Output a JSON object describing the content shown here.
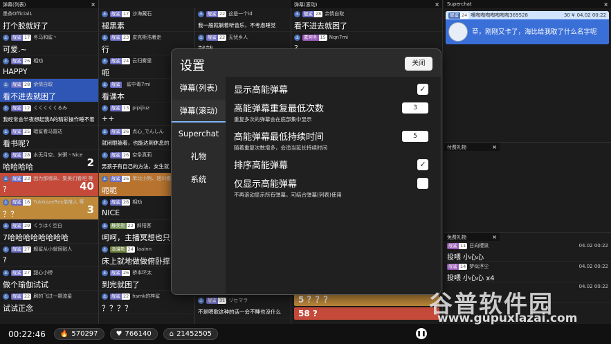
{
  "panels": {
    "list_title": "弹幕(列表)",
    "scroll_title": "弹幕(滚动)",
    "superchat_title": "Superchat",
    "paid_gift_title": "付费礼物",
    "free_gift_title": "免费礼物",
    "close": "×"
  },
  "col1": [
    {
      "user": "墨茶Official1",
      "text": "打个胶就好了",
      "style": ""
    },
    {
      "badge": "舰鲨",
      "level": "17",
      "user": "冬马和鲨丶",
      "text": "可爱.~",
      "style": ""
    },
    {
      "badge": "舰鲨",
      "level": "26",
      "user": "相劝",
      "text": "HAPPY",
      "style": ""
    },
    {
      "badge": "舰鲨",
      "level": "28",
      "user": "余情自取",
      "text": "看不进去就困了",
      "style": "hl-blue"
    },
    {
      "badge": "舰鲨",
      "level": "12",
      "user": "くくくくくるみ",
      "text": "我经常会半夜想起我A的精彩操作睡不着",
      "style": "",
      "small": true
    },
    {
      "badge": "舰鲨",
      "level": "25",
      "user": "暗鲨看马雷达",
      "text": "看书呢?",
      "style": ""
    },
    {
      "badge": "舰鲨",
      "level": "28",
      "user": "水无月空、米粥丶Nice",
      "text": "哈哈哈哈",
      "style": "",
      "count": "2"
    },
    {
      "badge": "舰鲨",
      "level": "23",
      "user": "因为那哪来、集美们看吧 等",
      "text": "?",
      "style": "hl-red",
      "count": "40"
    },
    {
      "badge": "舰鲨",
      "level": "16",
      "user": "YukikazeRex单推人 等",
      "text": "？？",
      "style": "hl-orange",
      "count": "3"
    },
    {
      "badge": "舰鲨",
      "level": "29",
      "user": "くうはく空白",
      "text": "7哈哈哈哈哈哈哈哈",
      "style": ""
    },
    {
      "badge": "舰鲨",
      "level": "27",
      "user": "舰鲨从小就很贴人",
      "text": "?",
      "style": ""
    },
    {
      "badge": "舰鲨",
      "level": "27",
      "user": "甜心小桥",
      "text": "做个瑜伽试试",
      "style": ""
    },
    {
      "badge": "舰鲨",
      "level": "22",
      "user": "刷的飞过一颗流星",
      "text": "试试正念",
      "style": ""
    }
  ],
  "col2": [
    {
      "badge": "舰鲨",
      "level": "17",
      "user": "沙海藏石",
      "text": "褪黑素",
      "style": ""
    },
    {
      "badge": "舰鲨",
      "level": "23",
      "user": "皮克斯浩着走",
      "text": "行",
      "style": ""
    },
    {
      "badge": "舰鲨",
      "level": "24",
      "user": "云归雾里",
      "text": "呃",
      "style": ""
    },
    {
      "badge": "舰鲨",
      "level": "",
      "user": "鲨中毒7mi",
      "text": "看课本",
      "style": ""
    },
    {
      "badge": "舰鲨",
      "level": "13",
      "user": "pipijiuz",
      "text": "++",
      "style": ""
    },
    {
      "badge": "舰鲨",
      "level": "26",
      "user": "点心_でんしん",
      "text": "就闭眼躺着，也能达到休息的",
      "style": "",
      "small": true
    },
    {
      "badge": "舰鲨",
      "level": "26",
      "user": "空条真莉",
      "text": "男孩子有自己的方法，女生就",
      "style": "",
      "small": true
    },
    {
      "badge": "舰鲨",
      "level": "26",
      "user": "苯比小狗、旭川看",
      "text": "呃呃",
      "style": "hl-dorange"
    },
    {
      "badge": "舰鲨",
      "level": "26",
      "user": "相劝",
      "text": "NICE",
      "style": ""
    },
    {
      "badge": "静美熊",
      "level": "22",
      "user": "斜阳客",
      "text": "呵呵，主播冥想也只会",
      "style": ""
    },
    {
      "badge": "浪漫熊",
      "level": "24",
      "user": "laainn",
      "text": "床上就地做做俯卧撑",
      "style": ""
    },
    {
      "badge": "舰鲨",
      "level": "26",
      "user": "桥本环太",
      "text": "到完就困了",
      "style": ""
    },
    {
      "badge": "舰鲨",
      "level": "22",
      "user": "hsmk的梓鲨",
      "text": "？？？？",
      "style": ""
    }
  ],
  "col3": [
    {
      "badge": "舰鲨",
      "level": "22",
      "user": "这是一个id",
      "text": "我一般就躺着听音乐，不考虑睡觉",
      "style": "",
      "small": true
    },
    {
      "badge": "舰鲨",
      "level": "22",
      "user": "无忧乡人",
      "text": "就就",
      "style": ""
    },
    {
      "badge": "舰鲨",
      "level": "31",
      "user": "リセマラ",
      "text": "不是嗯歌这种的话一会不睡也没什么",
      "style": "",
      "small": true,
      "bottom": true
    }
  ],
  "col4": [
    {
      "badge": "舰鲨",
      "level": "28",
      "user": "余情自取",
      "text": "看不进去就困了",
      "style": ""
    },
    {
      "badge": "素阿冬",
      "level": "15",
      "user": "Nqn7mi",
      "text": "?",
      "style": ""
    }
  ],
  "col4_bottom": [
    {
      "text": "5 ？？？",
      "style": "hl-orange"
    },
    {
      "text": "58 ?",
      "style": "hl-red"
    }
  ],
  "superchat": {
    "badge": "舰鲨",
    "level": "24",
    "user": "嘴啕啕啕啕啕啕啕369528",
    "price": "30 ¥",
    "time": "04.02 00:22",
    "text": "草，刚刚又卡了，海比给我取了什么名字呢"
  },
  "free_gifts": [
    {
      "badge": "舰鲨",
      "level": "11",
      "user": "日向櫻泉",
      "time": "04.02 00:22",
      "text": "投喂 小心心"
    },
    {
      "badge": "舰鲨",
      "level": "14",
      "user": "梦似浮尘",
      "time": "04.02 00:22",
      "text": "投喂 小心心 x4"
    },
    {
      "badge": "",
      "level": "",
      "user": "",
      "time": "04.02 00:22",
      "text": ""
    }
  ],
  "settings": {
    "title": "设置",
    "close_label": "关闭",
    "tabs": [
      "弹幕(列表)",
      "弹幕(滚动)",
      "Superchat",
      "礼物",
      "系统"
    ],
    "active_tab": 1,
    "show_highenergy": {
      "label": "显示高能弹幕",
      "checked": true
    },
    "min_repeat": {
      "label": "高能弹幕重复最低次数",
      "desc": "重复多次的弹幕会在底部集中显示",
      "value": "3"
    },
    "min_duration": {
      "label": "高能弹幕最低持续时间",
      "desc": "随着重复次数增多，会适当延长持续时间",
      "value": "5"
    },
    "sort_highenergy": {
      "label": "排序高能弹幕",
      "checked": true
    },
    "only_highenergy": {
      "label": "仅显示高能弹幕",
      "desc": "不再滚动显示所有弹幕，可结合弹幕(列表)使用",
      "checked": false
    }
  },
  "status_bar": {
    "time": "00:22:46",
    "fire_count": "570297",
    "heart_count": "766140",
    "home_count": "21452505"
  },
  "watermark": {
    "text": "谷普软件园",
    "url": "www.gupuxlazai.com"
  },
  "colors": {
    "accent": "#3a6fd8",
    "highlight_red": "#c54a3a",
    "highlight_orange": "#c08a3b",
    "tab_underline": "#7fb6ff"
  }
}
